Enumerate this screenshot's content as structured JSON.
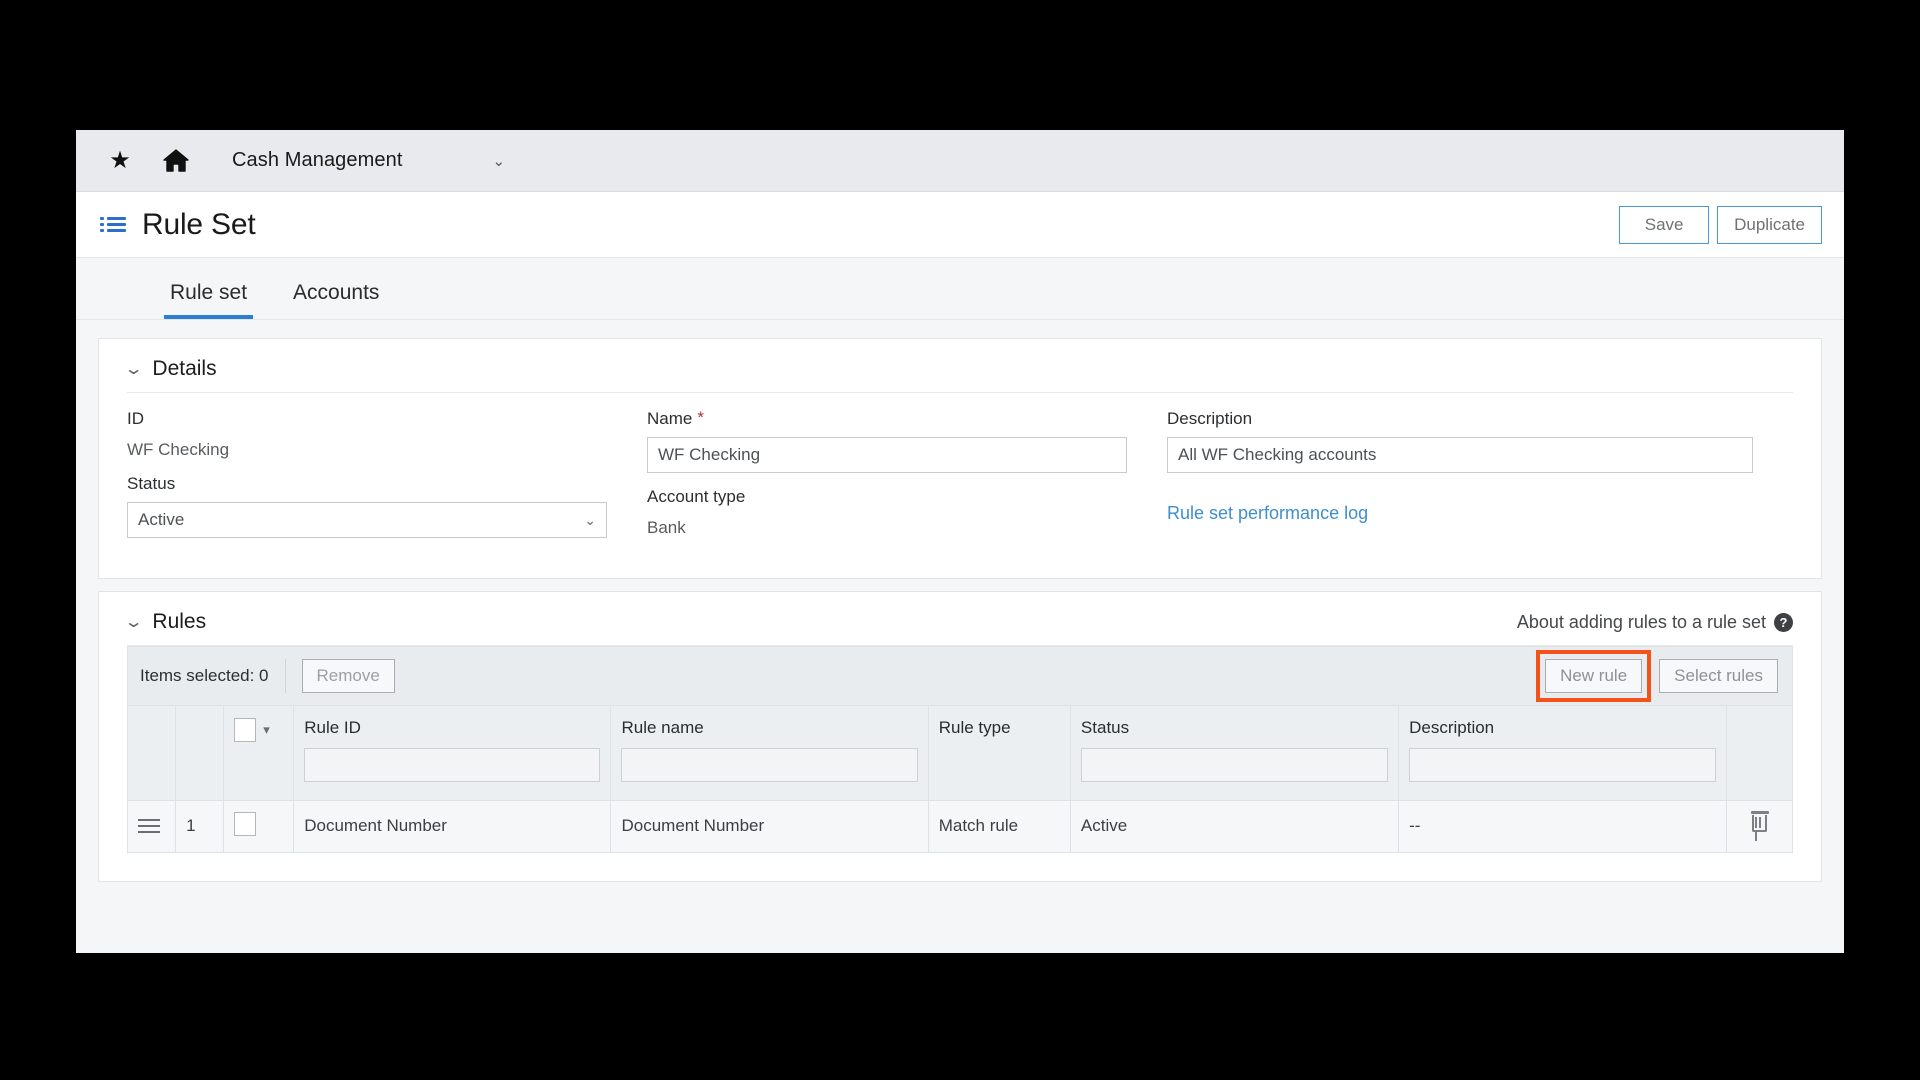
{
  "topbar": {
    "star_icon": "star-icon",
    "home_icon": "home-icon",
    "module": "Cash Management",
    "module_caret": "⌄"
  },
  "header": {
    "title": "Rule Set",
    "list_icon": "list-icon",
    "save_label": "Save",
    "duplicate_label": "Duplicate"
  },
  "tabs": [
    {
      "label": "Rule set",
      "active": true
    },
    {
      "label": "Accounts",
      "active": false
    }
  ],
  "details": {
    "section_title": "Details",
    "collapse_caret": "⌄",
    "id_label": "ID",
    "id_value": "WF Checking",
    "status_label": "Status",
    "status_value": "Active",
    "status_caret": "⌄",
    "name_label": "Name",
    "name_required": "*",
    "name_value": "WF Checking",
    "account_type_label": "Account type",
    "account_type_value": "Bank",
    "description_label": "Description",
    "description_value": "All WF Checking accounts",
    "performance_log_link": "Rule set performance log"
  },
  "rules": {
    "section_title": "Rules",
    "collapse_caret": "⌄",
    "about_link": "About adding rules to a rule set",
    "help_icon": "help-icon",
    "toolbar": {
      "items_selected": "Items selected: 0",
      "remove_label": "Remove",
      "new_rule_label": "New rule",
      "select_rules_label": "Select rules",
      "highlight_color": "#f4521b"
    },
    "columns": [
      {
        "label": "Rule ID",
        "filter": "",
        "has_filter": true
      },
      {
        "label": "Rule name",
        "filter": "",
        "has_filter": true
      },
      {
        "label": "Rule type",
        "filter": "",
        "has_filter": false
      },
      {
        "label": "Status",
        "filter": "",
        "has_filter": true
      },
      {
        "label": "Description",
        "filter": "",
        "has_filter": true
      }
    ],
    "rows": [
      {
        "number": "1",
        "rule_id": "Document Number",
        "rule_name": "Document Number",
        "rule_type": "Match rule",
        "status": "Active",
        "description": "--",
        "delete_icon": "trash-icon",
        "drag_icon": "drag-handle-icon"
      }
    ]
  },
  "colors": {
    "accent_blue": "#2a7fd4",
    "link_blue": "#3f8ed0",
    "highlight_orange": "#f4521b",
    "required_red": "#b5303a"
  }
}
